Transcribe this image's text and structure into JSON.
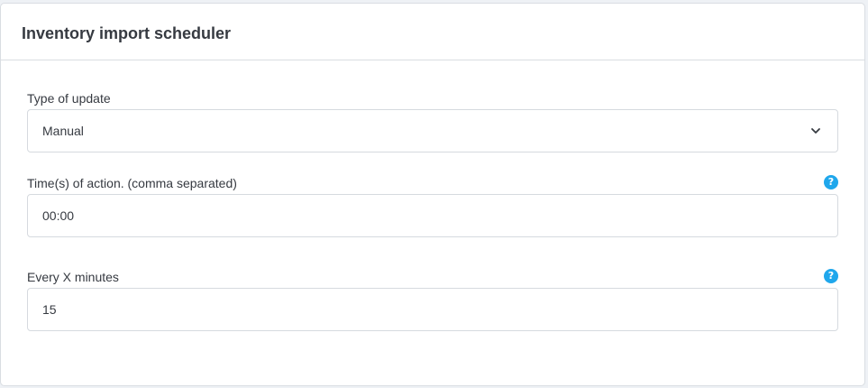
{
  "card": {
    "title": "Inventory import scheduler"
  },
  "fields": {
    "type_of_update": {
      "label": "Type of update",
      "value": "Manual",
      "control": "select"
    },
    "times_of_action": {
      "label": "Time(s) of action. (comma separated)",
      "value": "00:00",
      "help_icon": "question-circle-icon",
      "help_glyph": "?"
    },
    "every_x_minutes": {
      "label": "Every X minutes",
      "value": "15",
      "help_icon": "question-circle-icon",
      "help_glyph": "?"
    }
  },
  "colors": {
    "text": "#363a41",
    "border": "#d6dadf",
    "help_icon_bg": "#1fa7ec"
  }
}
